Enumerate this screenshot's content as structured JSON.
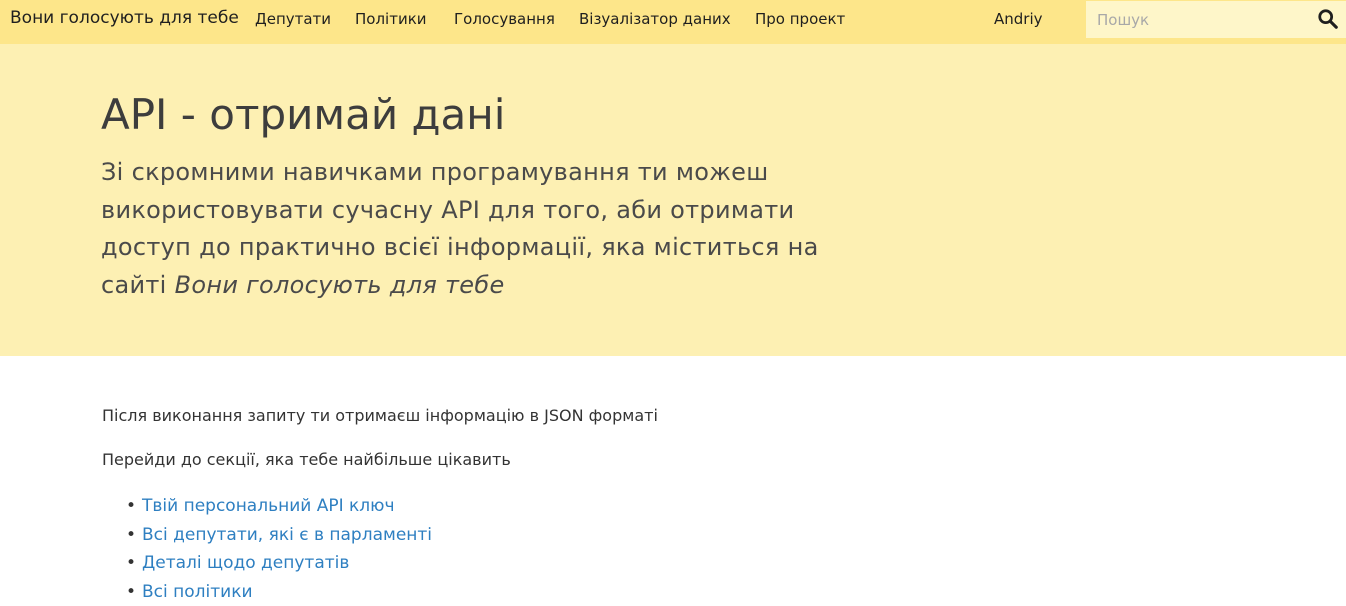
{
  "navbar": {
    "brand": "Вони голосують для тебе",
    "links": [
      "Депутати",
      "Політики",
      "Голосування",
      "Візуалізатор даних",
      "Про проект"
    ],
    "user": "Andriy",
    "search_placeholder": "Пошук",
    "search_icon": "magnifier-icon"
  },
  "hero": {
    "title": "API - отримай дані",
    "lead_text": "Зі скромними навичками програмування ти можеш використовувати сучасну API для того, аби отримати доступ до практично всієї інформації, яка міститься на сайті ",
    "lead_site_name": "Вони голосують для тебе"
  },
  "content": {
    "intro": "Після виконання запиту ти отримаєш інформацію в JSON форматі",
    "choose_section": "Перейди до секції, яка тебе найбільше цікавить",
    "sections": [
      "Твій персональний API ключ",
      "Всі депутати, які є в парламенті",
      "Деталі щодо депутатів",
      "Всі політики"
    ]
  },
  "colors": {
    "navbar_bg": "#fde68a",
    "hero_bg": "#fdf0b3",
    "link": "#2e7fc1"
  }
}
